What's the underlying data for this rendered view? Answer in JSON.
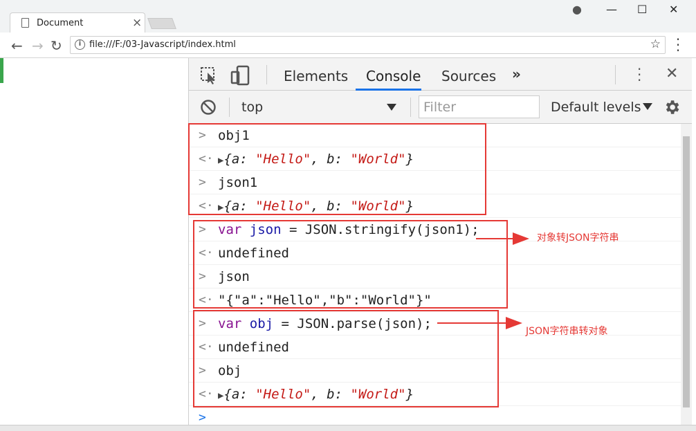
{
  "browser": {
    "tab_title": "Document",
    "tab_close": "×",
    "url": "file:///F:/03-Javascript/index.html",
    "info_glyph": "i",
    "bookmark_glyph": "☆",
    "nav_back": "←",
    "nav_forward": "→",
    "nav_reload": "↻",
    "win_account": "●",
    "win_minimize": "—",
    "win_maximize": "☐",
    "win_close": "✕"
  },
  "devtools": {
    "tabs": [
      "Elements",
      "Console",
      "Sources",
      "»"
    ],
    "active_tab": "Console",
    "context": "top",
    "filter_placeholder": "Filter",
    "levels": "Default levels",
    "close": "✕"
  },
  "console": {
    "input_prompt": ">",
    "output_prompt": "<·",
    "lines": [
      {
        "kind": "input",
        "text": "obj1"
      },
      {
        "kind": "output",
        "text": "{a: \"Hello\", b: \"World\"}"
      },
      {
        "kind": "input",
        "text": "json1"
      },
      {
        "kind": "output",
        "text": "{a: \"Hello\", b: \"World\"}"
      },
      {
        "kind": "input",
        "text": "var json = JSON.stringify(json1);"
      },
      {
        "kind": "output",
        "text": "undefined"
      },
      {
        "kind": "input",
        "text": "json"
      },
      {
        "kind": "output",
        "text": "\"{\"a\":\"Hello\",\"b\":\"World\"}\""
      },
      {
        "kind": "input",
        "text": "var obj = JSON.parse(json);"
      },
      {
        "kind": "output",
        "text": "undefined"
      },
      {
        "kind": "input",
        "text": "obj"
      },
      {
        "kind": "output",
        "text": "{a: \"Hello\", b: \"World\"}"
      }
    ]
  },
  "annotations": {
    "note1": "对象转JSON字符串",
    "note2": "JSON字符串转对象"
  },
  "colors": {
    "annotation_red": "#e53935",
    "console_keyword": "#881391",
    "console_string": "#c41a16",
    "active_tab_underline": "#1a73e8"
  }
}
